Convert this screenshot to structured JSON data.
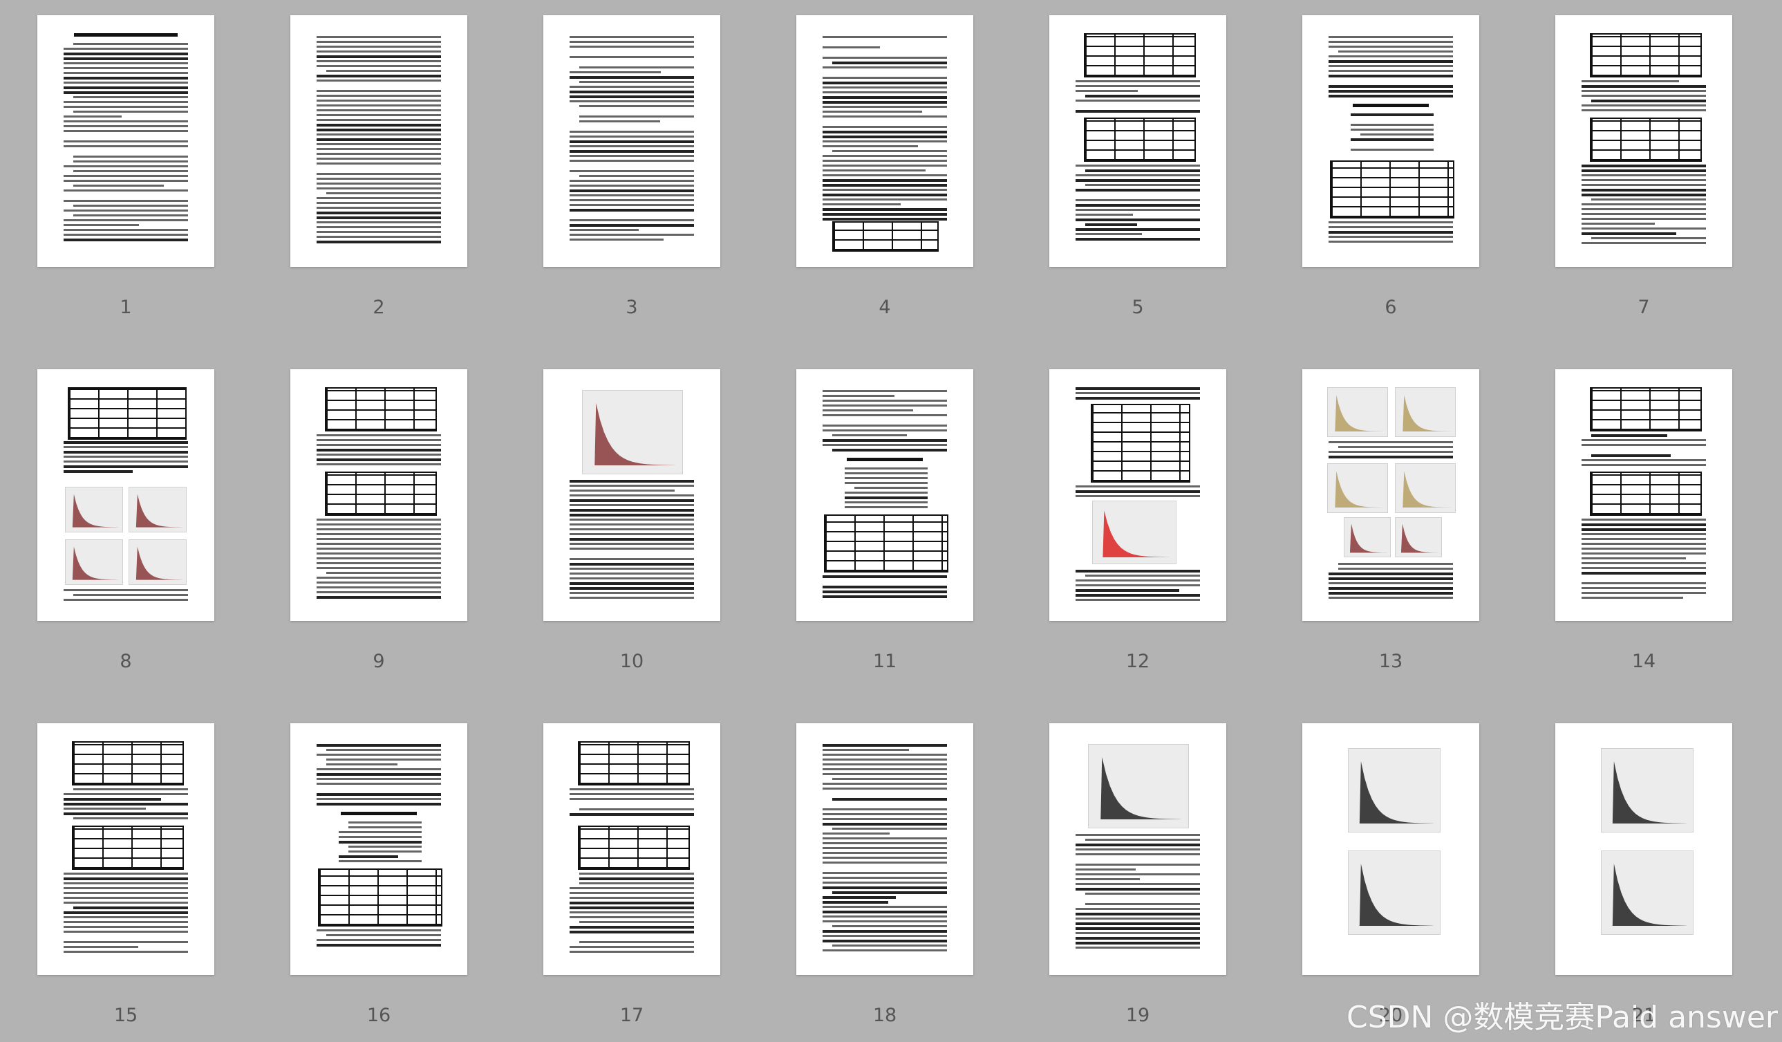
{
  "thumbnails": [
    {
      "number": "1"
    },
    {
      "number": "2"
    },
    {
      "number": "3"
    },
    {
      "number": "4"
    },
    {
      "number": "5"
    },
    {
      "number": "6"
    },
    {
      "number": "7"
    },
    {
      "number": "8"
    },
    {
      "number": "9"
    },
    {
      "number": "10"
    },
    {
      "number": "11"
    },
    {
      "number": "12"
    },
    {
      "number": "13"
    },
    {
      "number": "14"
    },
    {
      "number": "15"
    },
    {
      "number": "16"
    },
    {
      "number": "17"
    },
    {
      "number": "18"
    },
    {
      "number": "19"
    },
    {
      "number": "20"
    },
    {
      "number": "21"
    }
  ],
  "watermark": "CSDN @数模竞赛Paid answer",
  "colors": {
    "background": "#b3b3b3",
    "page": "#ffffff",
    "page_number": "#555555"
  }
}
